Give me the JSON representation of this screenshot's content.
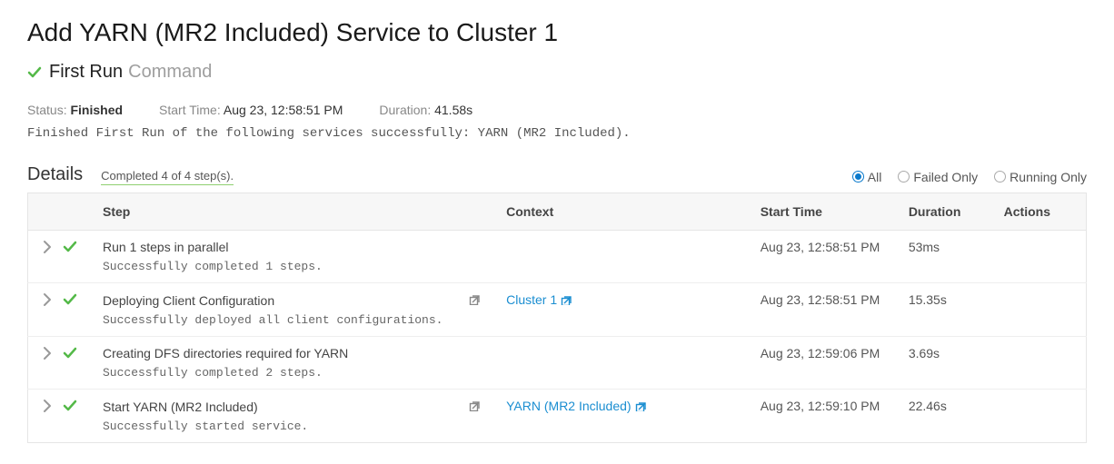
{
  "pageTitle": "Add YARN (MR2 Included) Service to Cluster 1",
  "command": {
    "name": "First Run",
    "suffix": "Command"
  },
  "meta": {
    "statusLabel": "Status:",
    "statusValue": "Finished",
    "startLabel": "Start Time:",
    "startValue": "Aug 23, 12:58:51 PM",
    "durationLabel": "Duration:",
    "durationValue": "41.58s"
  },
  "resultMessage": "Finished First Run of the following services successfully: YARN (MR2 Included).",
  "details": {
    "title": "Details",
    "completed": "Completed 4 of 4 step(s).",
    "filters": {
      "all": "All",
      "failed": "Failed Only",
      "running": "Running Only",
      "selected": "all"
    }
  },
  "columns": {
    "step": "Step",
    "context": "Context",
    "start": "Start Time",
    "duration": "Duration",
    "actions": "Actions"
  },
  "steps": [
    {
      "title": "Run 1 steps in parallel",
      "sub": "Successfully completed 1 steps.",
      "contextText": "",
      "hasExt": false,
      "start": "Aug 23, 12:58:51 PM",
      "duration": "53ms"
    },
    {
      "title": "Deploying Client Configuration",
      "sub": "Successfully deployed all client configurations.",
      "hasStepExt": true,
      "contextText": "Cluster 1",
      "hasExt": true,
      "start": "Aug 23, 12:58:51 PM",
      "duration": "15.35s"
    },
    {
      "title": "Creating DFS directories required for YARN",
      "sub": "Successfully completed 2 steps.",
      "contextText": "",
      "hasExt": false,
      "start": "Aug 23, 12:59:06 PM",
      "duration": "3.69s"
    },
    {
      "title": "Start YARN (MR2 Included)",
      "sub": "Successfully started service.",
      "hasStepExt": true,
      "contextText": "YARN (MR2 Included)",
      "hasExt": true,
      "start": "Aug 23, 12:59:10 PM",
      "duration": "22.46s"
    }
  ]
}
